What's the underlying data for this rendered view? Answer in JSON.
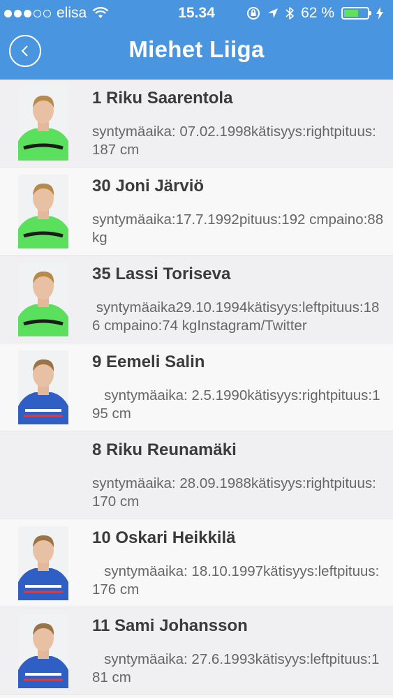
{
  "status_bar": {
    "carrier": "elisa",
    "time": "15.34",
    "battery": "62 %",
    "battery_level": 0.62
  },
  "header": {
    "title": "Miehet Liiga",
    "back_icon": "chevron-left-icon"
  },
  "colors": {
    "header": "#4a95df",
    "kit_green": "#5be05e",
    "kit_blue": "#2f5fc4"
  },
  "players": [
    {
      "name": "1 Riku Saarentola",
      "details": "syntymäaika: 07.02.1998kätisyys:rightpituus:187 cm",
      "kit": "green"
    },
    {
      "name": "30 Joni Järviö",
      "details": "syntymäaika:17.7.1992pituus:192 cmpaino:88 kg",
      "kit": "green"
    },
    {
      "name": "35 Lassi Toriseva",
      "details": " syntymäaika29.10.1994kätisyys:leftpituus:186 cmpaino:74 kgInstagram/Twitter",
      "kit": "green"
    },
    {
      "name": "9 Eemeli Salin",
      "details": "   syntymäaika: 2.5.1990kätisyys:rightpituus:195 cm",
      "kit": "blue"
    },
    {
      "name": "8 Riku Reunamäki",
      "details": "syntymäaika: 28.09.1988kätisyys:rightpituus:170 cm",
      "kit": "none"
    },
    {
      "name": "10 Oskari Heikkilä",
      "details": "   syntymäaika: 18.10.1997kätisyys:leftpituus:176 cm",
      "kit": "blue"
    },
    {
      "name": "11 Sami Johansson",
      "details": "   syntymäaika: 27.6.1993kätisyys:leftpituus:181 cm",
      "kit": "blue"
    }
  ]
}
